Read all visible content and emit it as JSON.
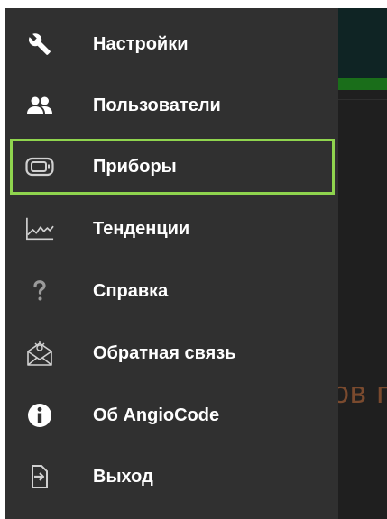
{
  "background": {
    "partial_title": "ов п"
  },
  "drawer": {
    "items": [
      {
        "label": "Настройки",
        "icon": "wrench-icon"
      },
      {
        "label": "Пользователи",
        "icon": "users-icon"
      },
      {
        "label": "Приборы",
        "icon": "device-icon",
        "selected": true
      },
      {
        "label": "Тенденции",
        "icon": "trend-chart-icon"
      },
      {
        "label": "Справка",
        "icon": "question-mark-icon"
      },
      {
        "label": "Обратная связь",
        "icon": "feedback-envelope-icon"
      },
      {
        "label": "Об AngioCode",
        "icon": "info-icon"
      },
      {
        "label": "Выход",
        "icon": "exit-icon"
      }
    ]
  },
  "colors": {
    "drawer_background": "#303030",
    "selection_border": "#8fd44e",
    "text": "#ffffff",
    "icon": "#cfcfcf"
  }
}
